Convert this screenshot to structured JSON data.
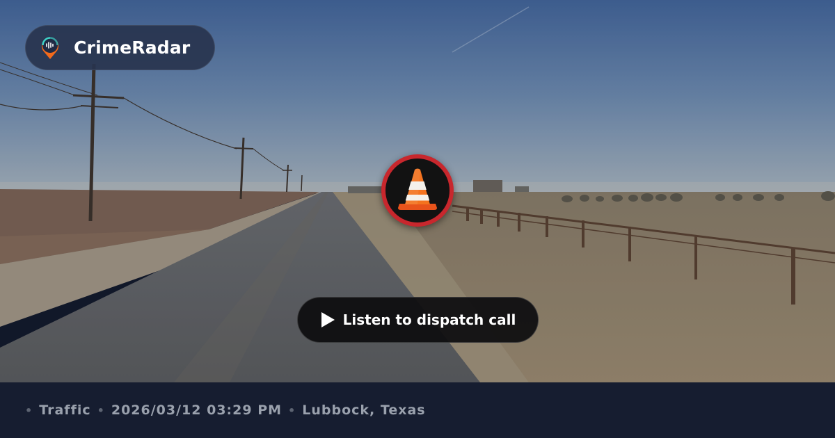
{
  "brand": {
    "name": "CrimeRadar",
    "logo_icon": "radar-pin-icon"
  },
  "incident": {
    "category_icon": "traffic-cone-icon",
    "badge_color": "#c8272d"
  },
  "actions": {
    "listen_label": "Listen to dispatch call",
    "play_icon": "play-icon"
  },
  "footer": {
    "category": "Traffic",
    "datetime": "2026/03/12 03:29 PM",
    "location": "Lubbock, Texas",
    "separator": "•"
  },
  "colors": {
    "footer_bg": "#161d30",
    "footer_text": "#9aa1ad",
    "accent_orange": "#f26a1b"
  }
}
